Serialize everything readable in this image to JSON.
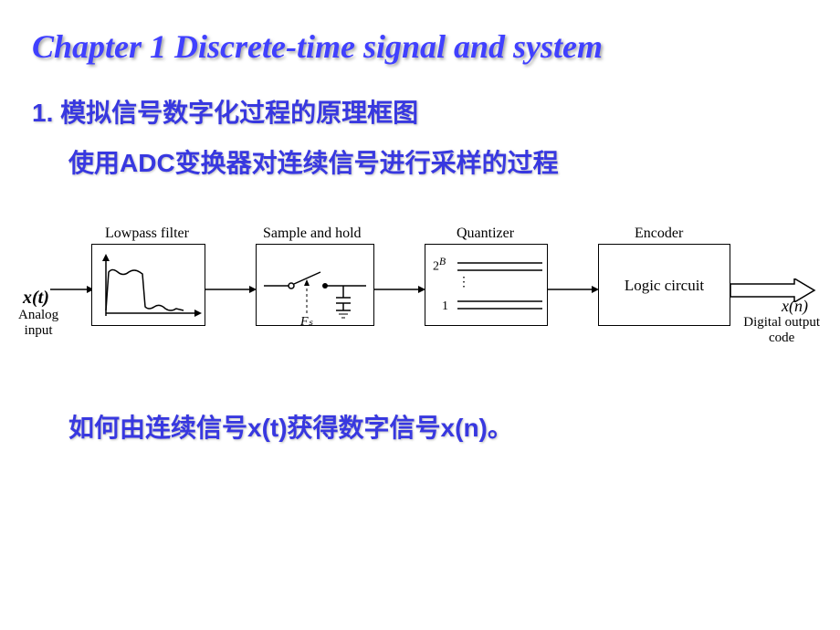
{
  "title": "Chapter 1 Discrete-time signal and system",
  "heading1": "1. 模拟信号数字化过程的原理框图",
  "heading2": "使用ADC变换器对连续信号进行采样的过程",
  "conclusion": "如何由连续信号x(t)获得数字信号x(n)。",
  "diagram": {
    "input_signal": "x(t)",
    "input_label": "Analog\ninput",
    "boxes": {
      "lowpass": "Lowpass filter",
      "sample_hold": "Sample and hold",
      "quantizer": "Quantizer",
      "encoder": "Encoder"
    },
    "sample_fs": "Fₛ",
    "quant_top": "2^B",
    "quant_bottom": "1",
    "encoder_text": "Logic circuit",
    "output_signal": "x(n)",
    "output_label": "Digital output\ncode"
  }
}
